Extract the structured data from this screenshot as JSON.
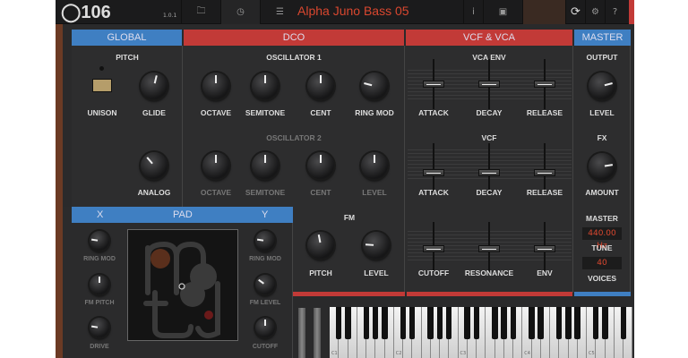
{
  "topbar": {
    "logo": "106",
    "version": "1.0.1",
    "preset": "Alpha Juno Bass 05",
    "icons": [
      "folder-icon",
      "clock-icon",
      "sliders-icon",
      "info-icon",
      "camera-icon",
      "power-icon",
      "gear-icon",
      "help-icon"
    ],
    "info": "i",
    "help": "?"
  },
  "sections": {
    "global": "GLOBAL",
    "dco": "DCO",
    "vcf": "VCF & VCA",
    "master": "MASTER"
  },
  "global": {
    "pitch": "PITCH",
    "unison": "UNISON",
    "glide": "GLIDE",
    "analog": "ANALOG",
    "knobs": {
      "glide": 0.55,
      "analog": 0.35
    }
  },
  "dco": {
    "osc1": "OSCILLATOR 1",
    "osc2": "OSCILLATOR 2",
    "octave": "OCTAVE",
    "semitone": "SEMITONE",
    "cent": "CENT",
    "ring_mod": "RING MOD",
    "level": "LEVEL",
    "knobs": {
      "o1oct": 0.5,
      "o1semi": 0.5,
      "o1cent": 0.5,
      "o1ring": 0.22,
      "o2oct": 0.5,
      "o2semi": 0.5,
      "o2cent": 0.5,
      "o2level": 0.5
    }
  },
  "fm": {
    "title": "FM",
    "pitch": "PITCH",
    "level": "LEVEL",
    "knobs": {
      "pitch": 0.46,
      "level": 0.18
    }
  },
  "vcf": {
    "vca_env": "VCA ENV",
    "vcf": "VCF",
    "attack": "ATTACK",
    "decay": "DECAY",
    "release": "RELEASE",
    "cutoff": "CUTOFF",
    "resonance": "RESONANCE",
    "env": "ENV",
    "sliders": {
      "vca_attack": 0.5,
      "vca_decay": 0.5,
      "vca_release": 0.5,
      "vcf_attack": 0.4,
      "vcf_decay": 0.4,
      "vcf_release": 0.4,
      "cutoff": 0.45,
      "resonance": 0.45,
      "env": 0.45
    }
  },
  "master": {
    "output": "OUTPUT",
    "level": "LEVEL",
    "fx": "FX",
    "amount": "AMOUNT",
    "master": "MASTER",
    "tune_value": "440.00 Hz",
    "tune": "TUNE",
    "voices_value": "40",
    "voices": "VOICES",
    "knobs": {
      "level": 0.78,
      "amount": 0.8
    }
  },
  "pad": {
    "x": "X",
    "title": "PAD",
    "y": "Y",
    "ring_mod": "RING MOD",
    "fm_pitch": "FM PITCH",
    "drive": "DRIVE",
    "fm_level": "FM LEVEL",
    "cutoff": "CUTOFF",
    "knobs": {
      "lring": 0.2,
      "lfm": 0.5,
      "ldrive": 0.2,
      "rring": 0.2,
      "rfm": 0.3,
      "rcut": 0.5
    }
  },
  "keyboard": {
    "labels": [
      "C1",
      "C2",
      "C3",
      "C4",
      "C5"
    ]
  },
  "colors": {
    "accent_red": "#c23a37",
    "accent_blue": "#3f7fc2",
    "display_text": "#d9472f"
  }
}
